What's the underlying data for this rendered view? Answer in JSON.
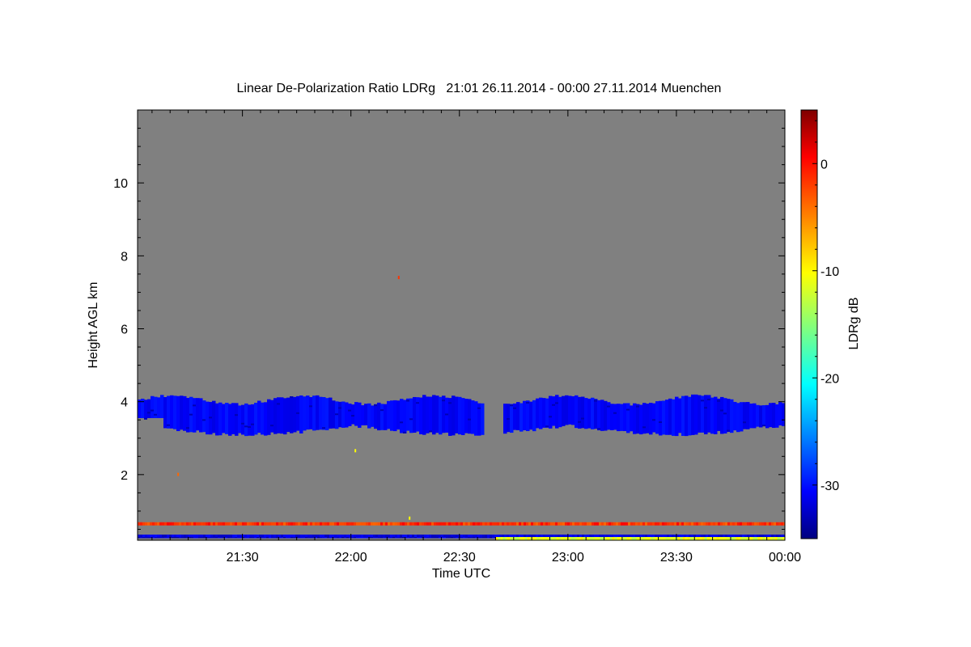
{
  "chart_data": {
    "type": "heatmap",
    "title": "Linear De-Polarization Ratio LDRg   21:01 26.11.2014 - 00:00 27.11.2014 Muenchen",
    "xlabel": "Time UTC",
    "ylabel": "Height AGL km",
    "xlim": [
      "21:01",
      "00:00"
    ],
    "ylim": [
      0.2,
      12
    ],
    "x_ticks": [
      "21:30",
      "22:00",
      "22:30",
      "23:00",
      "23:30",
      "00:00"
    ],
    "y_ticks": [
      2,
      4,
      6,
      8,
      10
    ],
    "colorbar": {
      "label": "LDRg dB",
      "range": [
        -35,
        5
      ],
      "ticks": [
        0,
        -10,
        -20,
        -30
      ],
      "colormap": "jet"
    },
    "background_color": "#808080",
    "layers": [
      {
        "kind": "cloud",
        "height_range_km": [
          3.0,
          4.2
        ],
        "ldr_db": -30,
        "gap_time_range": [
          "22:37",
          "22:42"
        ]
      },
      {
        "kind": "band",
        "height_km": 0.65,
        "ldr_db": -2
      },
      {
        "kind": "band",
        "height_km": 0.3,
        "ldr_db": -32
      },
      {
        "kind": "band",
        "height_km": 0.25,
        "ldr_db": -11,
        "time_range": [
          "22:40",
          "00:00"
        ]
      }
    ]
  }
}
